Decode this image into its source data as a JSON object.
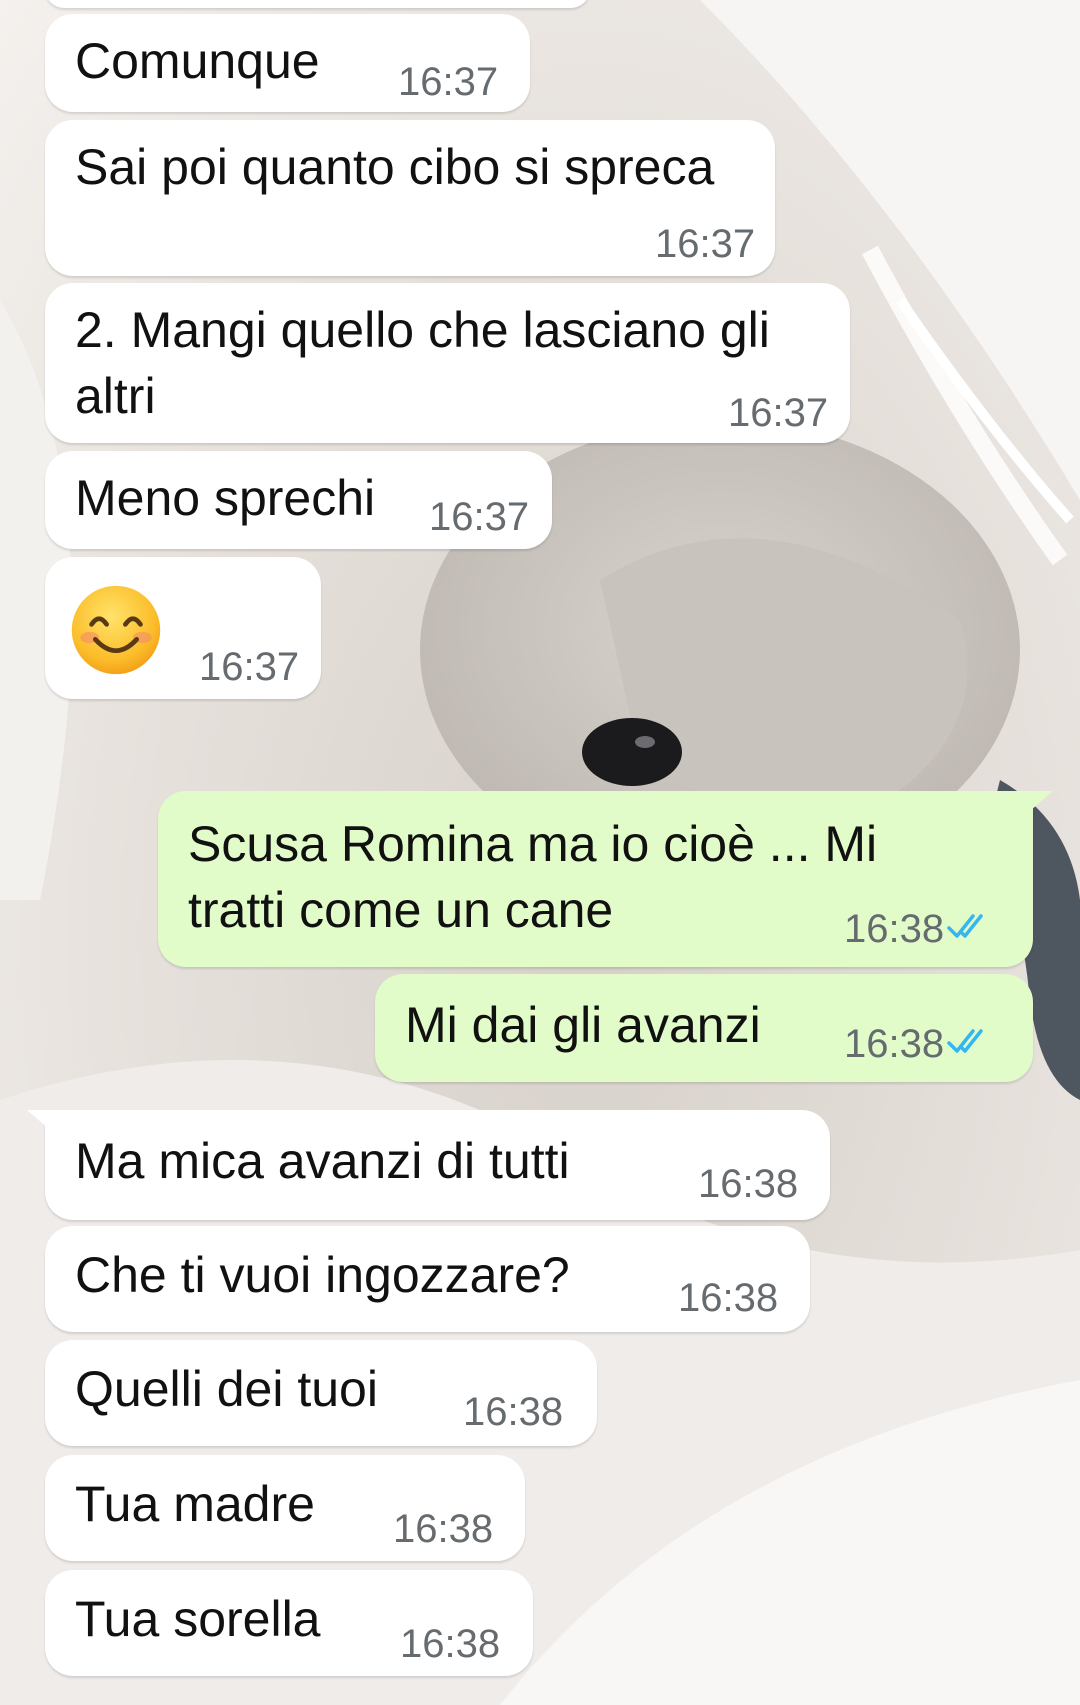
{
  "chat": {
    "messages": [
      {
        "id": "m1",
        "direction": "in",
        "text": "Comunque",
        "time": "16:37"
      },
      {
        "id": "m2",
        "direction": "in",
        "text": "Sai poi quanto cibo si spreca",
        "time": "16:37"
      },
      {
        "id": "m3",
        "direction": "in",
        "text": "2. Mangi quello che lasciano gli\naltri",
        "time": "16:37"
      },
      {
        "id": "m4",
        "direction": "in",
        "text": "Meno sprechi",
        "time": "16:37"
      },
      {
        "id": "m5",
        "direction": "in",
        "text": "",
        "emoji": "smiling-face-emoji",
        "time": "16:37"
      },
      {
        "id": "m6",
        "direction": "out",
        "text": "Scusa Romina ma io cioè ... Mi\ntratti come un cane",
        "time": "16:38",
        "status": "read"
      },
      {
        "id": "m7",
        "direction": "out",
        "text": "Mi dai gli avanzi",
        "time": "16:38",
        "status": "read"
      },
      {
        "id": "m8",
        "direction": "in",
        "text": "Ma mica avanzi di tutti",
        "time": "16:38"
      },
      {
        "id": "m9",
        "direction": "in",
        "text": "Che ti vuoi ingozzare?",
        "time": "16:38"
      },
      {
        "id": "m10",
        "direction": "in",
        "text": "Quelli dei tuoi",
        "time": "16:38"
      },
      {
        "id": "m11",
        "direction": "in",
        "text": "Tua madre",
        "time": "16:38"
      },
      {
        "id": "m12",
        "direction": "in",
        "text": "Tua sorella",
        "time": "16:38"
      }
    ]
  },
  "colors": {
    "incoming_bubble": "#ffffff",
    "outgoing_bubble": "#e1fcc9",
    "timestamp": "#666b6f",
    "read_ticks": "#34b7f1"
  },
  "icons": {
    "read_receipt": "double-check-icon",
    "emoji": "smiling-face-emoji"
  }
}
